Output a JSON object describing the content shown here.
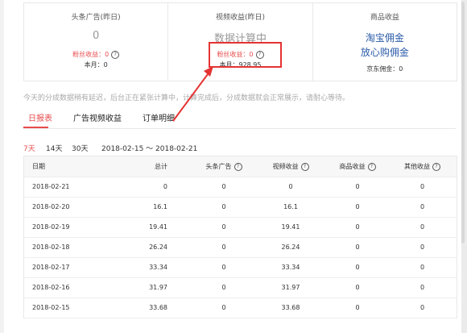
{
  "summary": {
    "col1": {
      "title": "头条广告(昨日)",
      "value": "0"
    },
    "col2": {
      "title": "视频收益(昨日)",
      "value": "数据计算中",
      "fans_label": "粉丝收益：0",
      "month_label": "本月：928.95"
    },
    "col3": {
      "title": "商品收益",
      "link1": "淘宝佣金",
      "link2": "放心购佣金",
      "jd_label": "京东佣金：0"
    },
    "col1_fans_label": "粉丝收益：0",
    "col1_month_label": "本月：0"
  },
  "notice": "今天的分成数据稍有延迟，后台正在紧张计算中，计算完成后，分成数据就会正常展示，请耐心等待。",
  "tabs": [
    "日报表",
    "广告视频收益",
    "订单明细"
  ],
  "ranges": {
    "r7": "7天",
    "r14": "14天",
    "r30": "30天",
    "dates": "2018-02-15 ～ 2018-02-21"
  },
  "table": {
    "headers": [
      "日期",
      "总计",
      "头条广告",
      "视频收益",
      "商品收益",
      "其他收益"
    ],
    "rows": [
      [
        "2018-02-21",
        "0",
        "0",
        "0",
        "0",
        "0"
      ],
      [
        "2018-02-20",
        "16.1",
        "0",
        "16.1",
        "0",
        "0"
      ],
      [
        "2018-02-19",
        "19.41",
        "0",
        "19.41",
        "0",
        "0"
      ],
      [
        "2018-02-18",
        "26.24",
        "0",
        "26.24",
        "0",
        "0"
      ],
      [
        "2018-02-17",
        "33.34",
        "0",
        "33.34",
        "0",
        "0"
      ],
      [
        "2018-02-16",
        "31.97",
        "0",
        "31.97",
        "0",
        "0"
      ],
      [
        "2018-02-15",
        "33.68",
        "0",
        "33.68",
        "0",
        "0"
      ]
    ]
  },
  "colors": {
    "accent": "#e84b4b",
    "link": "#2a5aa8",
    "annotation": "#e53333"
  }
}
